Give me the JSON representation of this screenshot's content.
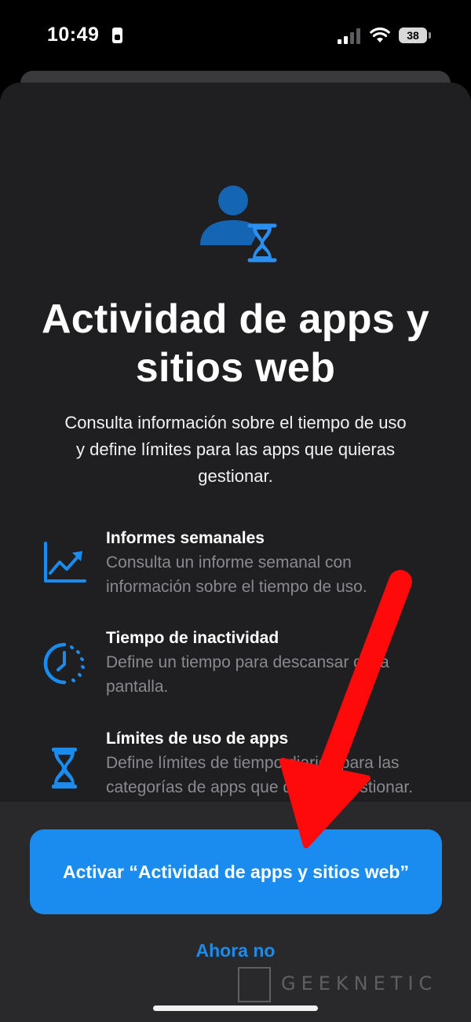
{
  "status_bar": {
    "time": "10:49",
    "battery": "38"
  },
  "colors": {
    "accent": "#1a8cf0",
    "sheet": "#1f1f21",
    "secondary_text": "#8a8a8e",
    "annotation_arrow": "#ff0a0a"
  },
  "hero": {
    "icon": "person-hourglass-icon",
    "title": "Actividad de apps y sitios web",
    "subtitle": "Consulta información sobre el tiempo de uso y define límites para las apps que quieras gestionar."
  },
  "features": [
    {
      "icon": "chart-trend-up-icon",
      "title": "Informes semanales",
      "description": "Consulta un informe semanal con información sobre el tiempo de uso."
    },
    {
      "icon": "downtime-clock-icon",
      "title": "Tiempo de inactividad",
      "description": "Define un tiempo para descansar de la pantalla."
    },
    {
      "icon": "hourglass-icon",
      "title": "Límites de uso de apps",
      "description": "Define límites de tiempo diarios para las categorías de apps que quieras gestionar."
    }
  ],
  "actions": {
    "primary": "Activar “Actividad de apps y sitios web”",
    "secondary": "Ahora no"
  },
  "watermark": {
    "text": "GEEKNETIC"
  }
}
